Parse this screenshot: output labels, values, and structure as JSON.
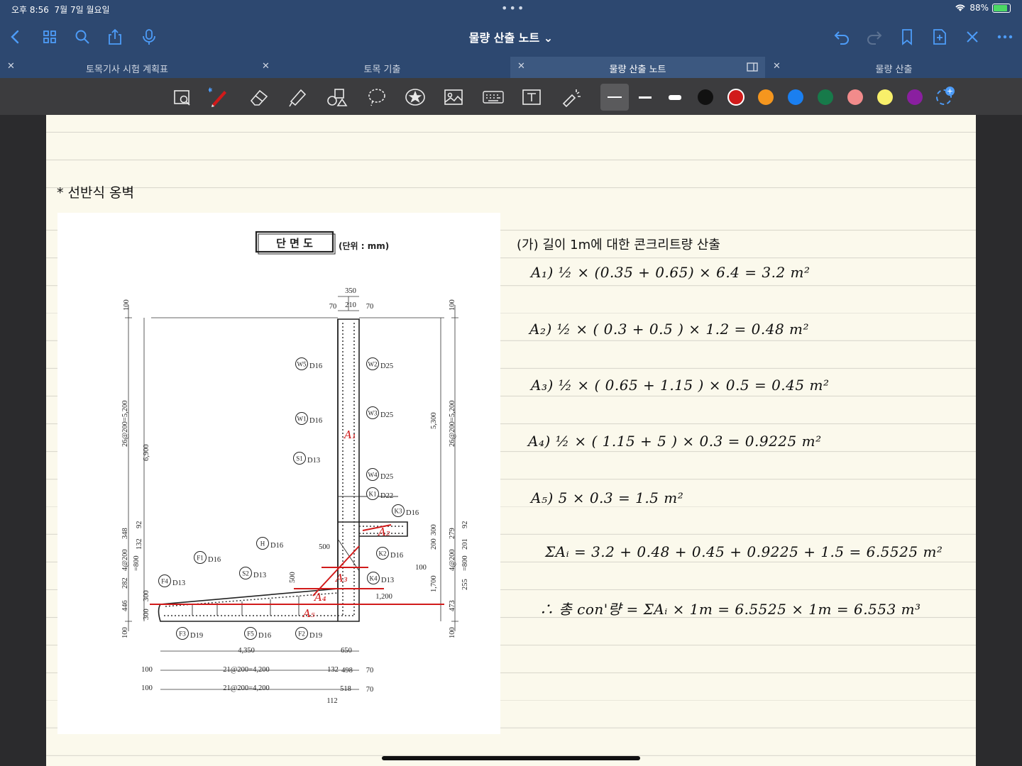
{
  "status": {
    "time": "오후 8:56",
    "date": "7월 7일 월요일",
    "battery": "88%"
  },
  "nav": {
    "title": "물량 산출 노트 ⌄"
  },
  "tabs": [
    {
      "label": "토목기사 시험 계획표"
    },
    {
      "label": "토목 기출"
    },
    {
      "label": "물량 산출 노트"
    },
    {
      "label": "물량 산출"
    }
  ],
  "toolbar": {
    "colors": [
      "#111111",
      "#d11a1a",
      "#f5961e",
      "#1a7ff0",
      "#177a4a",
      "#f28b8b",
      "#f8ef6a",
      "#8a1fa0"
    ]
  },
  "page": {
    "heading": "* 선반식 옹벽",
    "notes_title": "(가) 길이 1m에 대한 콘크리트량 산출",
    "lines": [
      "A₁)  ½ × (0.35 + 0.65) × 6.4 = 3.2 m²",
      "A₂)  ½ × ( 0.3 + 0.5 ) × 1.2 = 0.48 m²",
      "A₃)  ½ × ( 0.65 + 1.15 ) × 0.5 = 0.45 m²",
      "A₄)  ½ × ( 1.15 + 5 ) × 0.3 = 0.9225 m²",
      "A₅)  5 × 0.3 = 1.5 m²",
      "ΣAᵢ = 3.2 + 0.48 + 0.45 + 0.9225 + 1.5 = 6.5525 m²",
      "∴ 총 con'량 = ΣAᵢ × 1m = 6.5525 × 1m = 6.553 m³"
    ]
  },
  "drawing": {
    "box_title": "단 면 도",
    "unit": "(단위 : mm)",
    "top_dims": [
      "350",
      "70",
      "210",
      "70"
    ],
    "rebar": [
      {
        "mark": "W5",
        "dia": "D16"
      },
      {
        "mark": "W2",
        "dia": "D25"
      },
      {
        "mark": "W1",
        "dia": "D16"
      },
      {
        "mark": "W3",
        "dia": "D25"
      },
      {
        "mark": "S1",
        "dia": "D13"
      },
      {
        "mark": "W4",
        "dia": "D25"
      },
      {
        "mark": "K1",
        "dia": "D22"
      },
      {
        "mark": "K3",
        "dia": "D16"
      },
      {
        "mark": "H",
        "dia": "D16"
      },
      {
        "mark": "K2",
        "dia": "D16"
      },
      {
        "mark": "F1",
        "dia": "D16"
      },
      {
        "mark": "S2",
        "dia": "D13"
      },
      {
        "mark": "K4",
        "dia": "D13"
      },
      {
        "mark": "F4",
        "dia": "D13"
      },
      {
        "mark": "F3",
        "dia": "D19"
      },
      {
        "mark": "F5",
        "dia": "D16"
      },
      {
        "mark": "F2",
        "dia": "D19"
      }
    ],
    "dims": {
      "left_top": "100",
      "left_main": "26@200=5,200",
      "left_total": "6,900",
      "left_a": "348",
      "left_b": "132",
      "left_c": "92",
      "left_d": "4@200",
      "left_e": "=800",
      "left_f": "282",
      "left_g": "446",
      "left_h": "300",
      "left_i": "300",
      "left_bot": "100",
      "right_top": "100",
      "right_main": "26@200=5,200",
      "right_h": "5,300",
      "right_a": "279",
      "right_b": "92",
      "right_c": "201",
      "right_d": "200",
      "right_e": "300",
      "right_f": "4@200",
      "right_g": "=800",
      "right_h2": "1,700",
      "right_i": "255",
      "right_j": "473",
      "right_bot": "100",
      "d500a": "500",
      "d500b": "500",
      "d100": "100",
      "d1200": "1,200",
      "b4350": "4,350",
      "b650": "650",
      "b100a": "100",
      "b21a": "21@200=4,200",
      "b132": "132",
      "b498": "498",
      "b70a": "70",
      "b100b": "100",
      "b21b": "21@200=4,200",
      "b518": "518",
      "b70b": "70",
      "b112": "112"
    },
    "areas": [
      "A₁",
      "A₂",
      "A₃",
      "A₄",
      "A₅"
    ]
  }
}
